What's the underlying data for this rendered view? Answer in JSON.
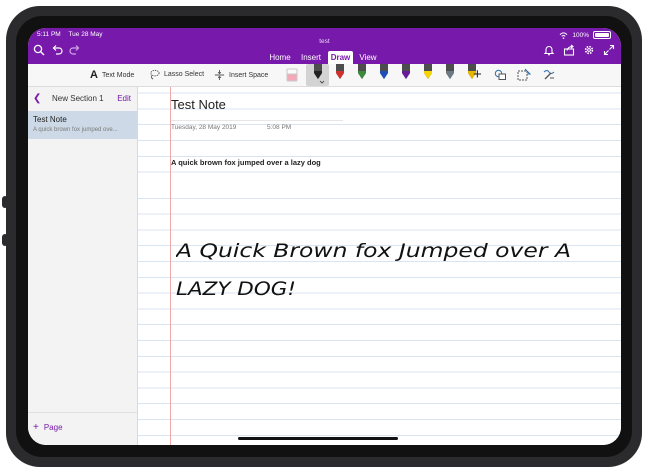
{
  "status_bar": {
    "time": "5:11 PM",
    "date": "Tue 28 May",
    "battery": "100%"
  },
  "document_title": "test",
  "ribbon": {
    "tabs": [
      "Home",
      "Insert",
      "Draw",
      "View"
    ],
    "active_tab": "Draw"
  },
  "toolbar": {
    "text_mode": "Text Mode",
    "lasso_select": "Lasso Select",
    "insert_space": "Insert Space",
    "pens": [
      {
        "name": "pen-black-selected",
        "color": "#222222"
      },
      {
        "name": "pen-red",
        "color": "#d0312d"
      },
      {
        "name": "pen-green",
        "color": "#3b8a3b"
      },
      {
        "name": "pen-blue",
        "color": "#1e4fb8"
      },
      {
        "name": "pen-purple",
        "color": "#6a1b9a"
      },
      {
        "name": "highlighter-yellow",
        "color": "#f5d400"
      },
      {
        "name": "pen-gray",
        "color": "#6b7a85"
      },
      {
        "name": "highlighter-gold",
        "color": "#e8b800"
      }
    ]
  },
  "sidebar": {
    "section_name": "New Section 1",
    "edit_label": "Edit",
    "pages": [
      {
        "title": "Test Note",
        "snippet": "A quick brown fox jumped ove..."
      }
    ],
    "add_page_label": "Page"
  },
  "note": {
    "title": "Test Note",
    "date": "Tuesday, 28 May 2019",
    "time": "5:08 PM",
    "typed_text": "A quick brown fox jumped over a lazy dog",
    "handwriting_line_1": "A Quick Brown fox Jumped over A",
    "handwriting_line_2": "LAZY DOG!"
  },
  "colors": {
    "accent": "#7719aa",
    "selected_page": "#cdd9e6",
    "margin_line": "#f0a8a8",
    "rule_line": "#d9e6f2"
  }
}
